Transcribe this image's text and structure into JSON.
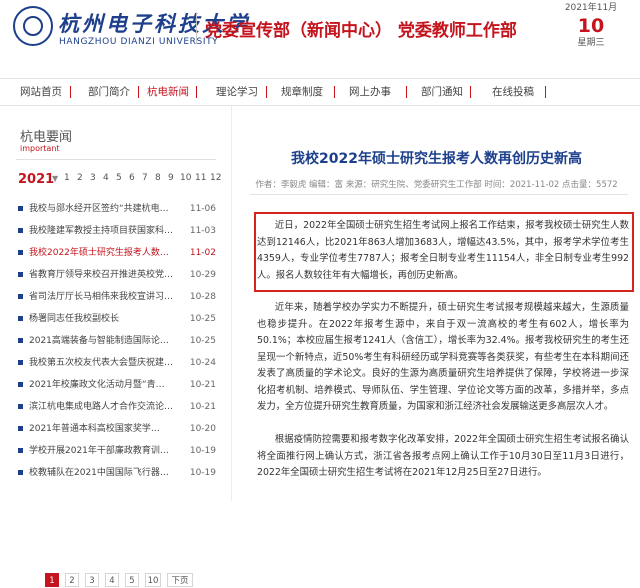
{
  "header": {
    "logo_cn": "杭州电子科技大学",
    "logo_en": "HANGZHOU DIANZI UNIVERSITY",
    "dept_title": "党委宣传部（新闻中心） 党委教师工作部",
    "date": {
      "year_month": "2021年11月",
      "day": "10",
      "weekday": "星期三"
    }
  },
  "nav": {
    "items": [
      "网站首页",
      "部门简介",
      "杭电新闻",
      "理论学习",
      "规章制度",
      "网上办事",
      "部门通知",
      "在线投稿"
    ],
    "active": "杭电新闻"
  },
  "sidebar": {
    "title": "杭电要闻",
    "subtitle": "important",
    "year": "2021",
    "months": [
      "1",
      "2",
      "3",
      "4",
      "5",
      "6",
      "7",
      "8",
      "9",
      "10",
      "11",
      "12"
    ],
    "news": [
      {
        "title": "我校与郧水经开区签约“共建杭电…",
        "date": "11-06"
      },
      {
        "title": "我校隆建军教授主持项目获国家科…",
        "date": "11-03"
      },
      {
        "title": "我校2022年硕士研究生报考人数…",
        "date": "11-02",
        "active": true
      },
      {
        "title": "省教育厅领导来校召开推进英校党…",
        "date": "10-29"
      },
      {
        "title": "省司法厅厅长马相伟来我校宣讲习…",
        "date": "10-28"
      },
      {
        "title": "杨署同志任我校副校长",
        "date": "10-25"
      },
      {
        "title": "2021高端装备与智能制造国际论…",
        "date": "10-25"
      },
      {
        "title": "我校第五次校友代表大会暨庆祝建…",
        "date": "10-24"
      },
      {
        "title": "2021年校廉政文化活动月暨“青…",
        "date": "10-21"
      },
      {
        "title": "滨江杭电集成电路人才合作交流论…",
        "date": "10-21"
      },
      {
        "title": "2021年普通本科高校国家奖学…",
        "date": "10-20"
      },
      {
        "title": "学校开展2021年干部廉政教育训…",
        "date": "10-19"
      },
      {
        "title": "校教辅队在2021中国国际飞行器…",
        "date": "10-19"
      }
    ],
    "pager": [
      "1",
      "2",
      "3",
      "4",
      "5",
      "10",
      "下页"
    ]
  },
  "article": {
    "title": "我校2022年硕士研究生报考人数再创历史新高",
    "meta": "作者：李毅虎 编辑：富 来源：研究生院、党委研究生工作部   时间：2021-11-02 点击量：5572",
    "paragraphs": [
      "近日，2022年全国硕士研究生招生考试网上报名工作结束，报考我校硕士研究生人数达到12146人，比2021年863人增加3683人，增幅达43.5%，其中，报考学术学位考生4359人，专业学位考生7787人；报考全日制专业考生11154人，非全日制专业考生992人。报名人数较往年有大幅增长，再创历史新高。",
      "近年来，随着学校办学实力不断提升，硕士研究生考试报考规模越来越大，生源质量也稳步提升。在2022年报考生源中，来自于双一流高校的考生有602人，增长率为 50.1%；本校应届生报考1241人（含信工），增长率为32.4%。报考我校研究生的考生还呈现一个新特点，近50%考生有科研经历或学科竞赛等各类获奖，有些考生在本科期间还发表了高质量的学术论文。良好的生源为高质量研究生培养提供了保障，学校将进一步深化招考机制、培养模式、导师队伍、学生管理、学位论文等方面的改革，多措并举，多点发力，全方位提升研究生教育质量，为国家和浙江经济社会发展输送更多高层次人才。",
      "根据疫情防控需要和报考数字化改革安排，2022年全国硕士研究生招生考试报名确认将全面推行网上确认方式，浙江省各报考点网上确认工作于10月30日至11月3日进行，2022年全国硕士研究生招生考试将在2021年12月25日至27日进行。"
    ]
  },
  "colors": {
    "brand_red": "#c4141d",
    "brand_blue": "#1d3f8c"
  }
}
